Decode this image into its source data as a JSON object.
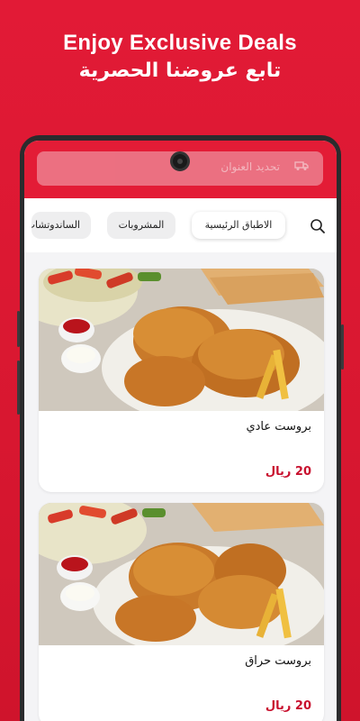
{
  "promo": {
    "title": "Enjoy Exclusive Deals",
    "subtitle": "تابع عروضنا الحصرية"
  },
  "header": {
    "address_label": "تحديد العنوان",
    "address_icon": "delivery-icon",
    "accent_color": "#e31c36"
  },
  "tabs": [
    {
      "label": "الاطباق الرئيسية",
      "active": true
    },
    {
      "label": "المشروبات",
      "active": false
    },
    {
      "label": "الساندوتشات",
      "active": false
    }
  ],
  "search": {
    "icon": "search-icon"
  },
  "products": [
    {
      "name": "بروست عادي",
      "price": "20 ريال"
    },
    {
      "name": "بروست حراق",
      "price": "20 ريال"
    }
  ]
}
